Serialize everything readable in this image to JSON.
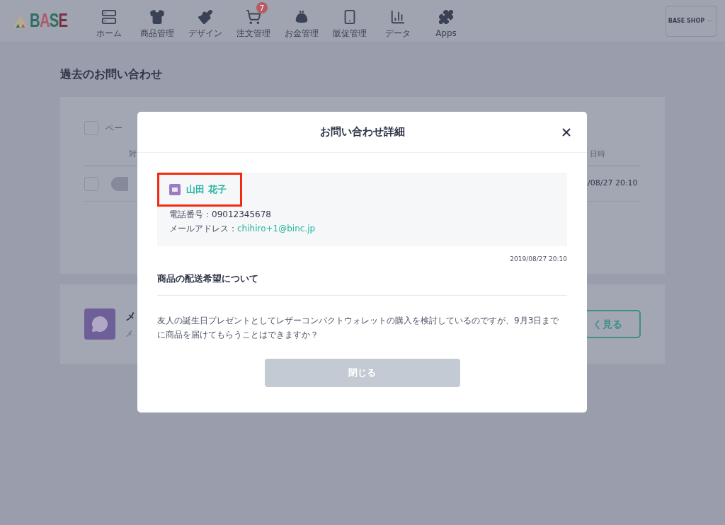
{
  "header": {
    "logo": "BASE",
    "nav": [
      {
        "kind": "home",
        "label": "ホーム"
      },
      {
        "kind": "shirt",
        "label": "商品管理"
      },
      {
        "kind": "brush",
        "label": "デザイン"
      },
      {
        "kind": "cart",
        "label": "注文管理",
        "badge": "7"
      },
      {
        "kind": "purse",
        "label": "お金管理"
      },
      {
        "kind": "phone",
        "label": "販促管理"
      },
      {
        "kind": "chart",
        "label": "データ"
      },
      {
        "kind": "puzzle",
        "label": "Apps"
      }
    ],
    "shop_button": "BASE SHOP"
  },
  "page_title": "過去のお問い合わせ",
  "inquiries_card": {
    "select_all_checked": false,
    "select_all_label": "ペー",
    "column_1": "対",
    "date_column": "日時",
    "rows": [
      {
        "checked": false,
        "date": "/08/27 20:10"
      }
    ]
  },
  "message_card": {
    "title": "メ",
    "subtitle": "メ",
    "button": "く見る"
  },
  "modal": {
    "title": "お問い合わせ詳細",
    "contact": {
      "name": "山田 花子",
      "highlighted": true,
      "phone_label": "電話番号：",
      "phone": "09012345678",
      "email_label": "メールアドレス：",
      "email": "chihiro+1@binc.jp"
    },
    "date": "2019/08/27 20:10",
    "subject": "商品の配送希望について",
    "body": "友人の誕生日プレゼントとしてレザーコンパクトウォレットの購入を検討しているのですが、9月3日までに商品を届けてもらうことはできますか？",
    "close_button": "閉じる"
  }
}
